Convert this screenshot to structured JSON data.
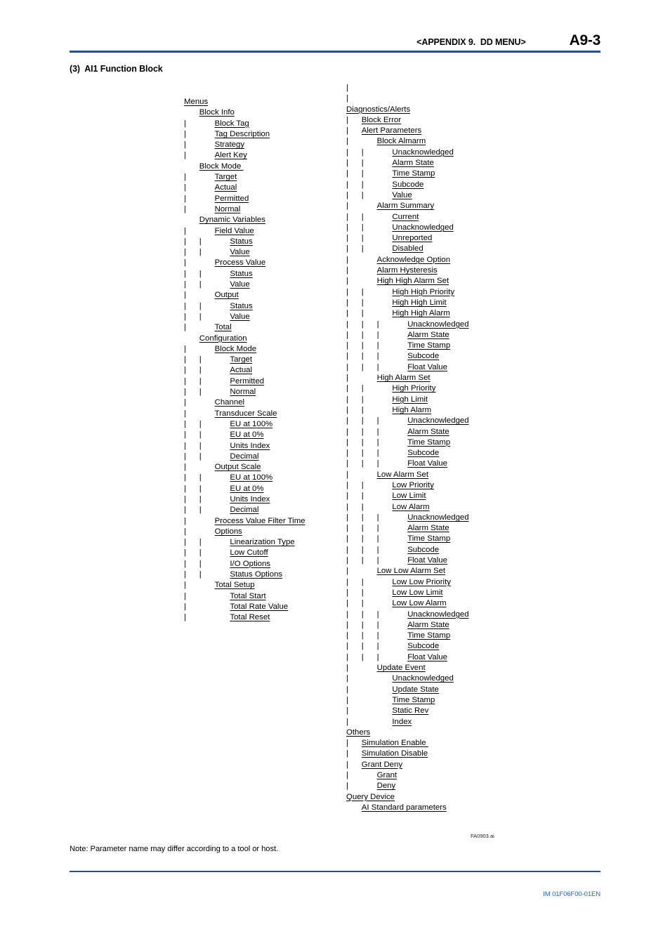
{
  "header": {
    "appendix": "<APPENDIX 9.  DD MENU>",
    "page_number": "A9-3",
    "rule_color": "#1f4e9c"
  },
  "section": {
    "title": "(3)  AI1 Function Block"
  },
  "figure_id": "FA0903.ai",
  "note": "Note: Parameter name may differ according to a tool or host.",
  "footer": {
    "document_code": "IM 01F06F00-01EN",
    "code_color": "#2a62b8",
    "rule_color": "#1f4e9c"
  },
  "tree_left": [
    {
      "pipes": "",
      "label": "Menus"
    },
    {
      "pipes": "",
      "label": "Block Info",
      "indent": 1
    },
    {
      "pipes": "|",
      "label": "Block Tag",
      "indent": 2
    },
    {
      "pipes": "|",
      "label": "Tag Description",
      "indent": 2
    },
    {
      "pipes": "|",
      "label": "Strategy",
      "indent": 2
    },
    {
      "pipes": "|",
      "label": "Alert Key",
      "indent": 2
    },
    {
      "pipes": "",
      "label": "Block Mode ",
      "indent": 1
    },
    {
      "pipes": "|",
      "label": "Target",
      "indent": 2
    },
    {
      "pipes": "|",
      "label": "Actual",
      "indent": 2
    },
    {
      "pipes": "|",
      "label": "Permitted",
      "indent": 2
    },
    {
      "pipes": "|",
      "label": "Normal",
      "indent": 2
    },
    {
      "pipes": "",
      "label": "Dynamic Variables",
      "indent": 1
    },
    {
      "pipes": "|",
      "label": "Field Value",
      "indent": 2
    },
    {
      "pipes": "|  |",
      "label": "Status",
      "indent": 3
    },
    {
      "pipes": "|  |",
      "label": "Value",
      "indent": 3
    },
    {
      "pipes": "|",
      "label": "Process Value",
      "indent": 2
    },
    {
      "pipes": "|  |",
      "label": "Status",
      "indent": 3
    },
    {
      "pipes": "|  |",
      "label": "Value",
      "indent": 3
    },
    {
      "pipes": "|",
      "label": "Output",
      "indent": 2
    },
    {
      "pipes": "|  |",
      "label": "Status",
      "indent": 3
    },
    {
      "pipes": "|  |",
      "label": "Value",
      "indent": 3
    },
    {
      "pipes": "|",
      "label": "Total",
      "indent": 2
    },
    {
      "pipes": "",
      "label": "Configuration",
      "indent": 1
    },
    {
      "pipes": "|",
      "label": "Block Mode",
      "indent": 2
    },
    {
      "pipes": "|  |",
      "label": "Target",
      "indent": 3
    },
    {
      "pipes": "|  |",
      "label": "Actual",
      "indent": 3
    },
    {
      "pipes": "|  |",
      "label": "Permitted",
      "indent": 3
    },
    {
      "pipes": "|  |",
      "label": "Normal",
      "indent": 3
    },
    {
      "pipes": "|",
      "label": "Channel",
      "indent": 2
    },
    {
      "pipes": "|",
      "label": "Transducer Scale",
      "indent": 2
    },
    {
      "pipes": "|  |",
      "label": "EU at 100%",
      "indent": 3
    },
    {
      "pipes": "|  |",
      "label": "EU at 0%",
      "indent": 3
    },
    {
      "pipes": "|  |",
      "label": "Units Index",
      "indent": 3
    },
    {
      "pipes": "|  |",
      "label": "Decimal",
      "indent": 3
    },
    {
      "pipes": "|",
      "label": "Output Scale",
      "indent": 2
    },
    {
      "pipes": "|  |",
      "label": "EU at 100%",
      "indent": 3
    },
    {
      "pipes": "|  |",
      "label": "EU at 0%",
      "indent": 3
    },
    {
      "pipes": "|  |",
      "label": "Units Index",
      "indent": 3
    },
    {
      "pipes": "|  |",
      "label": "Decimal",
      "indent": 3
    },
    {
      "pipes": "|",
      "label": "Process Value Filter Time",
      "indent": 2
    },
    {
      "pipes": "|",
      "label": "Options",
      "indent": 2
    },
    {
      "pipes": "|  |",
      "label": "Linearization Type",
      "indent": 3
    },
    {
      "pipes": "|  |",
      "label": "Low Cutoff",
      "indent": 3
    },
    {
      "pipes": "|  |",
      "label": "I/O Options",
      "indent": 3
    },
    {
      "pipes": "|  |",
      "label": "Status Options",
      "indent": 3
    },
    {
      "pipes": "|",
      "label": "Total Setup",
      "indent": 2
    },
    {
      "pipes": "|",
      "label": "Total Start",
      "indent": 3
    },
    {
      "pipes": "|",
      "label": "Total Rate Value",
      "indent": 3
    },
    {
      "pipes": "|",
      "label": "Total Reset",
      "indent": 3
    }
  ],
  "tree_right": [
    {
      "pipes": "|",
      "label": ""
    },
    {
      "pipes": "|",
      "label": ""
    },
    {
      "pipes": "",
      "label": "Diagnostics/Alerts"
    },
    {
      "pipes": "|",
      "label": "Block Error",
      "indent": 1
    },
    {
      "pipes": "|",
      "label": "Alert Parameters",
      "indent": 1
    },
    {
      "pipes": "|",
      "label": "Block Almarm",
      "indent": 2
    },
    {
      "pipes": "|  |",
      "label": "Unacknowledged",
      "indent": 3
    },
    {
      "pipes": "|  |",
      "label": "Alarm State",
      "indent": 3
    },
    {
      "pipes": "|  |",
      "label": "Time Stamp",
      "indent": 3
    },
    {
      "pipes": "|  |",
      "label": "Subcode",
      "indent": 3
    },
    {
      "pipes": "|  |",
      "label": "Value",
      "indent": 3
    },
    {
      "pipes": "|",
      "label": "Alarm Summary",
      "indent": 2
    },
    {
      "pipes": "|  |",
      "label": "Current",
      "indent": 3
    },
    {
      "pipes": "|  |",
      "label": "Unacknowledged",
      "indent": 3
    },
    {
      "pipes": "|  |",
      "label": "Unreported",
      "indent": 3
    },
    {
      "pipes": "|  |",
      "label": "Disabled",
      "indent": 3
    },
    {
      "pipes": "|",
      "label": "Acknowledge Option",
      "indent": 2
    },
    {
      "pipes": "|",
      "label": "Alarm Hysteresis",
      "indent": 2
    },
    {
      "pipes": "|",
      "label": "High High Alarm Set",
      "indent": 2
    },
    {
      "pipes": "|  |",
      "label": "High High Priority",
      "indent": 3
    },
    {
      "pipes": "|  |",
      "label": "High High Limit",
      "indent": 3
    },
    {
      "pipes": "|  |",
      "label": "High High Alarm",
      "indent": 3
    },
    {
      "pipes": "|  |  |",
      "label": "Unacknowledged",
      "indent": 4
    },
    {
      "pipes": "|  |  |",
      "label": "Alarm State",
      "indent": 4
    },
    {
      "pipes": "|  |  |",
      "label": "Time Stamp",
      "indent": 4
    },
    {
      "pipes": "|  |  |",
      "label": "Subcode",
      "indent": 4
    },
    {
      "pipes": "|  |  |",
      "label": "Float Value",
      "indent": 4
    },
    {
      "pipes": "|",
      "label": "High Alarm Set",
      "indent": 2
    },
    {
      "pipes": "|  |",
      "label": "High Priority",
      "indent": 3
    },
    {
      "pipes": "|  |",
      "label": "High Limit",
      "indent": 3
    },
    {
      "pipes": "|  |",
      "label": "High Alarm",
      "indent": 3
    },
    {
      "pipes": "|  |  |",
      "label": "Unacknowledged",
      "indent": 4
    },
    {
      "pipes": "|  |  |",
      "label": "Alarm State",
      "indent": 4
    },
    {
      "pipes": "|  |  |",
      "label": "Time Stamp",
      "indent": 4
    },
    {
      "pipes": "|  |  |",
      "label": "Subcode",
      "indent": 4
    },
    {
      "pipes": "|  |  |",
      "label": "Float Value",
      "indent": 4
    },
    {
      "pipes": "|",
      "label": "Low Alarm Set",
      "indent": 2
    },
    {
      "pipes": "|  |",
      "label": "Low Priority",
      "indent": 3
    },
    {
      "pipes": "|  |",
      "label": "Low Limit",
      "indent": 3
    },
    {
      "pipes": "|  |",
      "label": "Low Alarm",
      "indent": 3
    },
    {
      "pipes": "|  |  |",
      "label": "Unacknowledged",
      "indent": 4
    },
    {
      "pipes": "|  |  |",
      "label": "Alarm State",
      "indent": 4
    },
    {
      "pipes": "|  |  |",
      "label": "Time Stamp",
      "indent": 4
    },
    {
      "pipes": "|  |  |",
      "label": "Subcode",
      "indent": 4
    },
    {
      "pipes": "|  |  |",
      "label": "Float Value",
      "indent": 4
    },
    {
      "pipes": "|",
      "label": "Low Low Alarm Set",
      "indent": 2
    },
    {
      "pipes": "|  |",
      "label": "Low Low Priority",
      "indent": 3
    },
    {
      "pipes": "|  |",
      "label": "Low Low Limit",
      "indent": 3
    },
    {
      "pipes": "|  |",
      "label": "Low Low Alarm",
      "indent": 3
    },
    {
      "pipes": "|  |  |",
      "label": "Unacknowledged",
      "indent": 4
    },
    {
      "pipes": "|  |  |",
      "label": "Alarm State",
      "indent": 4
    },
    {
      "pipes": "|  |  |",
      "label": "Time Stamp",
      "indent": 4
    },
    {
      "pipes": "|  |  |",
      "label": "Subcode",
      "indent": 4
    },
    {
      "pipes": "|  |  |",
      "label": "Float Value",
      "indent": 4
    },
    {
      "pipes": "|",
      "label": "Update Event",
      "indent": 2
    },
    {
      "pipes": "|",
      "label": "Unacknowledged",
      "indent": 3
    },
    {
      "pipes": "|",
      "label": "Update State",
      "indent": 3
    },
    {
      "pipes": "|",
      "label": "Time Stamp",
      "indent": 3
    },
    {
      "pipes": "|",
      "label": "Static Rev",
      "indent": 3
    },
    {
      "pipes": "|",
      "label": "Index",
      "indent": 3
    },
    {
      "pipes": "",
      "label": "Others"
    },
    {
      "pipes": "|",
      "label": "Simulation Enable ",
      "indent": 1
    },
    {
      "pipes": "|",
      "label": "Simulation Disable",
      "indent": 1
    },
    {
      "pipes": "|",
      "label": "Grant Deny",
      "indent": 1
    },
    {
      "pipes": "|",
      "label": "Grant",
      "indent": 2
    },
    {
      "pipes": "|",
      "label": "Deny",
      "indent": 2
    },
    {
      "pipes": "",
      "label": "Query Device"
    },
    {
      "pipes": "",
      "label": "AI Standard parameters",
      "indent": 1
    }
  ]
}
